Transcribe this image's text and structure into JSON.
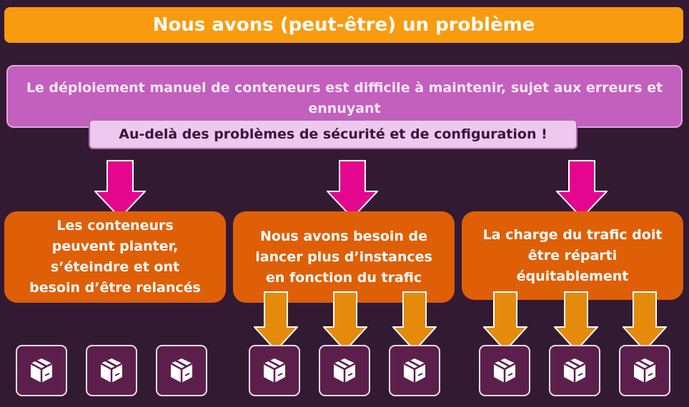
{
  "title": "Nous avons (peut-être) un problème",
  "problem": "Le déploiement manuel de conteneurs est difficile à maintenir, sujet aux erreurs et ennuyant",
  "note": "Au-delà des problèmes de sécurité et de configuration !",
  "issues": [
    "Les conteneurs\npeuvent planter,\ns’éteindre et ont\nbesoin d’être relancés",
    "Nous avons besoin de\nlancer plus d’instances\nen fonction du trafic",
    "La charge du trafic doit\nêtre réparti\néquitablement"
  ],
  "icons": {
    "container": "package-box-icon",
    "pink_arrow": "arrow-down-icon",
    "orange_arrow": "arrow-down-icon"
  },
  "colors": {
    "background": "#331a33",
    "title_bar": "#f89b0e",
    "problem_box": "#c35fbd",
    "note_box": "#eec8ee",
    "issue_box": "#df5f07",
    "pink_arrow": "#e5068f",
    "orange_arrow": "#e58a0a",
    "tile": "#5c1f4c"
  }
}
